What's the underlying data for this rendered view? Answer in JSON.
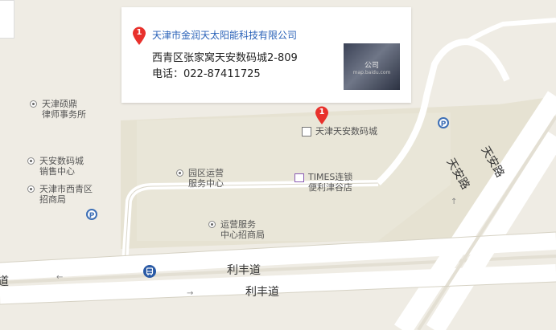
{
  "info_window": {
    "marker_number": "1",
    "title": "天津市金润天太阳能科技有限公司",
    "address": "西青区张家窝天安数码城2-809",
    "phone": "电话：022-87411725",
    "thumbnail_label": "公司",
    "thumbnail_caption": "map.baidu.com"
  },
  "main_marker": {
    "number": "1"
  },
  "pois": [
    {
      "name": "天津硕鼎\n律师事务所"
    },
    {
      "name": "天安数码城\n销售中心"
    },
    {
      "name": "天津市西青区\n招商局"
    },
    {
      "name": "园区运营\n服务中心"
    },
    {
      "name": "运营服务\n中心招商局"
    },
    {
      "name": "TIMES连锁\n便利津谷店"
    },
    {
      "name": "天津天安数码城"
    }
  ],
  "roads": {
    "lifeng_upper": "利丰道",
    "lifeng_lower": "利丰道",
    "lifeng_left": "道",
    "tianan_upper": "天安路",
    "tianan_lower": "天安路"
  },
  "icons": {
    "parking": "P",
    "bus": "bus-icon"
  },
  "colors": {
    "marker": "#e8312c",
    "link": "#2a62b8",
    "parking": "#3d6fb6",
    "bus": "#2a5aa5"
  }
}
